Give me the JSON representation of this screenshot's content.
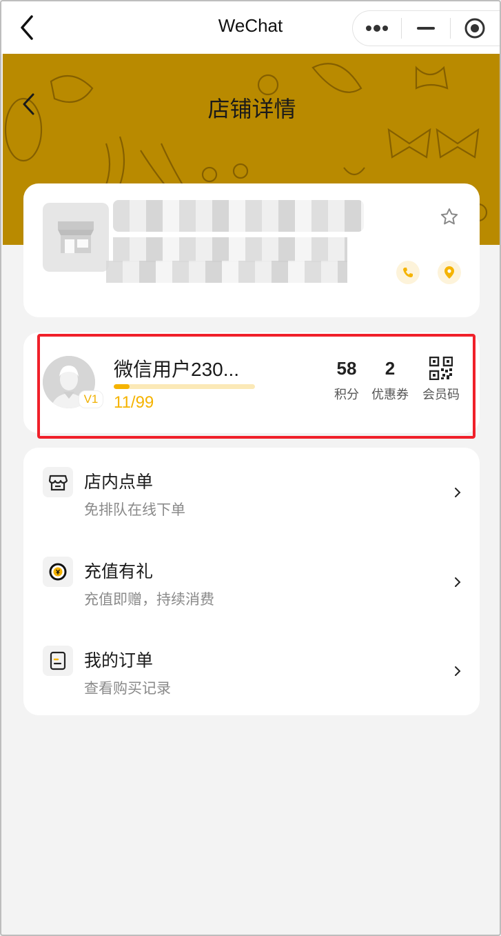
{
  "wechat_bar": {
    "title": "WeChat",
    "capsule": [
      "more-icon",
      "minimize-icon",
      "close-target-icon"
    ]
  },
  "header": {
    "title": "店铺详情",
    "banner_color": "#b98a00"
  },
  "store": {
    "thumb_icon": "shop-icon",
    "favorite_icon": "star-icon",
    "phone_icon": "phone-icon",
    "location_icon": "location-icon"
  },
  "member": {
    "name": "微信用户230...",
    "level": "V1",
    "progress_current": 11,
    "progress_max": 99,
    "progress_text": "11/99",
    "points_value": "58",
    "points_label": "积分",
    "coupons_value": "2",
    "coupons_label": "优惠券",
    "qr_label": "会员码"
  },
  "menu": [
    {
      "title": "店内点单",
      "subtitle": "免排队在线下单",
      "icon": "store-order-icon"
    },
    {
      "title": "充值有礼",
      "subtitle": "充值即赠，持续消费",
      "icon": "coin-icon"
    },
    {
      "title": "我的订单",
      "subtitle": "查看购买记录",
      "icon": "order-list-icon"
    }
  ],
  "colors": {
    "accent": "#f5b300",
    "highlight_border": "#f0202a"
  }
}
